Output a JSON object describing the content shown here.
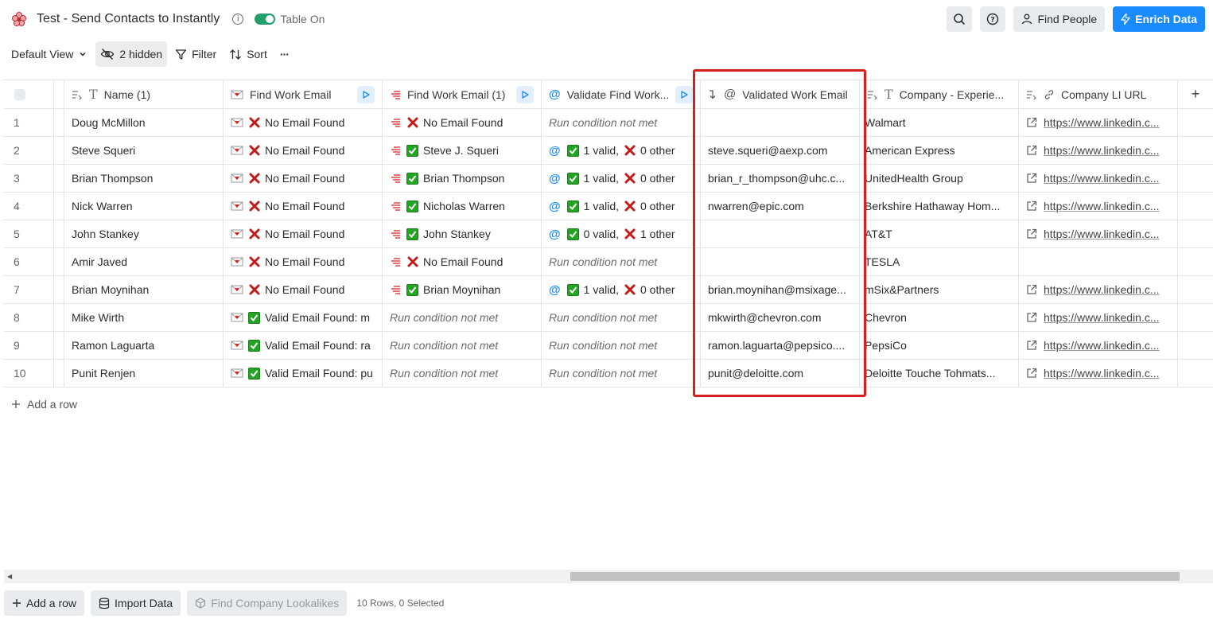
{
  "header": {
    "title": "Test - Send Contacts to Instantly",
    "toggle_label": "Table On",
    "find_people_label": "Find People",
    "enrich_label": "Enrich Data"
  },
  "toolbar": {
    "view_label": "Default View",
    "hidden_label": "2 hidden",
    "filter_label": "Filter",
    "sort_label": "Sort",
    "more_label": "···"
  },
  "columns": [
    {
      "label": "Name (1)",
      "icon": "text-icon"
    },
    {
      "label": "Find Work Email",
      "icon": "envelope-icon",
      "run": true
    },
    {
      "label": "Find Work Email (1)",
      "icon": "lines-icon",
      "run": true
    },
    {
      "label": "Validate Find Work...",
      "icon": "at-icon",
      "run": true
    },
    {
      "label": "Validated Work Email",
      "icon": "at-icon"
    },
    {
      "label": "Company - Experie...",
      "icon": "text-icon"
    },
    {
      "label": "Company LI URL",
      "icon": "link-icon"
    }
  ],
  "add_column_label": "+",
  "rows": [
    {
      "n": "1",
      "name": "Doug McMillon",
      "fwe": {
        "ok": false,
        "text": "No Email Found"
      },
      "fwe1": {
        "state": "x",
        "text": "No Email Found"
      },
      "val": {
        "state": "none",
        "text": "Run condition not met"
      },
      "email": "",
      "company": "Walmart",
      "url": "https://www.linkedin.c..."
    },
    {
      "n": "2",
      "name": "Steve Squeri",
      "fwe": {
        "ok": false,
        "text": "No Email Found"
      },
      "fwe1": {
        "state": "ok",
        "text": "Steve J. Squeri"
      },
      "val": {
        "state": "at",
        "valid": "1 valid,",
        "other": "0 other"
      },
      "email": "steve.squeri@aexp.com",
      "company": "American Express",
      "url": "https://www.linkedin.c..."
    },
    {
      "n": "3",
      "name": "Brian Thompson",
      "fwe": {
        "ok": false,
        "text": "No Email Found"
      },
      "fwe1": {
        "state": "ok",
        "text": "Brian Thompson"
      },
      "val": {
        "state": "at",
        "valid": "1 valid,",
        "other": "0 other"
      },
      "email": "brian_r_thompson@uhc.c...",
      "company": "UnitedHealth Group",
      "url": "https://www.linkedin.c..."
    },
    {
      "n": "4",
      "name": "Nick Warren",
      "fwe": {
        "ok": false,
        "text": "No Email Found"
      },
      "fwe1": {
        "state": "ok",
        "text": "Nicholas Warren"
      },
      "val": {
        "state": "at",
        "valid": "1 valid,",
        "other": "0 other"
      },
      "email": "nwarren@epic.com",
      "company": "Berkshire Hathaway Hom...",
      "url": "https://www.linkedin.c..."
    },
    {
      "n": "5",
      "name": "John Stankey",
      "fwe": {
        "ok": false,
        "text": "No Email Found"
      },
      "fwe1": {
        "state": "ok",
        "text": "John Stankey"
      },
      "val": {
        "state": "at",
        "valid": "0 valid,",
        "other": "1 other"
      },
      "email": "",
      "company": "AT&T",
      "url": "https://www.linkedin.c..."
    },
    {
      "n": "6",
      "name": "Amir Javed",
      "fwe": {
        "ok": false,
        "text": "No Email Found"
      },
      "fwe1": {
        "state": "x",
        "text": "No Email Found"
      },
      "val": {
        "state": "none",
        "text": "Run condition not met"
      },
      "email": "",
      "company": "TESLA",
      "url": ""
    },
    {
      "n": "7",
      "name": "Brian Moynihan",
      "fwe": {
        "ok": false,
        "text": "No Email Found"
      },
      "fwe1": {
        "state": "ok",
        "text": "Brian Moynihan"
      },
      "val": {
        "state": "at",
        "valid": "1 valid,",
        "other": "0 other"
      },
      "email": "brian.moynihan@msixage...",
      "company": "mSix&Partners",
      "url": "https://www.linkedin.c..."
    },
    {
      "n": "8",
      "name": "Mike Wirth",
      "fwe": {
        "ok": true,
        "text": "Valid Email Found: m"
      },
      "fwe1": {
        "state": "none",
        "text": "Run condition not met"
      },
      "val": {
        "state": "none",
        "text": "Run condition not met"
      },
      "email": "mkwirth@chevron.com",
      "company": "Chevron",
      "url": "https://www.linkedin.c..."
    },
    {
      "n": "9",
      "name": "Ramon Laguarta",
      "fwe": {
        "ok": true,
        "text": "Valid Email Found: ra"
      },
      "fwe1": {
        "state": "none",
        "text": "Run condition not met"
      },
      "val": {
        "state": "none",
        "text": "Run condition not met"
      },
      "email": "ramon.laguarta@pepsico....",
      "company": "PepsiCo",
      "url": "https://www.linkedin.c..."
    },
    {
      "n": "10",
      "name": "Punit Renjen",
      "fwe": {
        "ok": true,
        "text": "Valid Email Found: pu"
      },
      "fwe1": {
        "state": "none",
        "text": "Run condition not met"
      },
      "val": {
        "state": "none",
        "text": "Run condition not met"
      },
      "email": "punit@deloitte.com",
      "company": "Deloitte Touche Tohmats...",
      "url": "https://www.linkedin.c..."
    }
  ],
  "add_row_label": "Add a row",
  "footer": {
    "add_row_label": "Add a row",
    "import_label": "Import Data",
    "lookalikes_label": "Find Company Lookalikes",
    "status": "10 Rows, 0 Selected"
  },
  "colors": {
    "accent": "#1a8cff",
    "highlight": "#d62020",
    "success": "#25a325",
    "error": "#c41a1a"
  }
}
